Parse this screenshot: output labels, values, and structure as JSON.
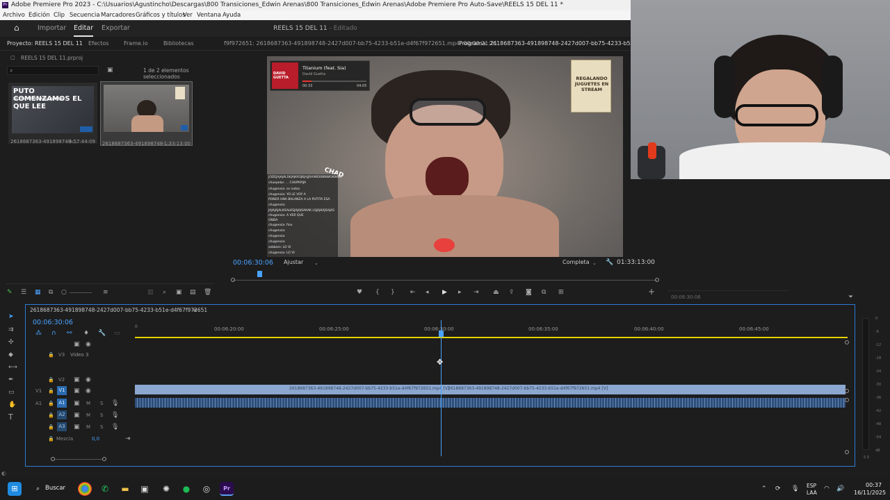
{
  "window": {
    "title": "Adobe Premiere Pro 2023 - C:\\Usuarios\\Agustincho\\Descargas\\800 Transiciones_Edwin Arenas\\800 Transiciones_Edwin Arenas\\Adobe Premiere Pro Auto-Save\\REELS 15 DEL 11 *"
  },
  "menu": [
    "Archivo",
    "Edición",
    "Clip",
    "Secuencia",
    "Marcadores",
    "Gráficos y títulos",
    "Ver",
    "Ventana",
    "Ayuda"
  ],
  "appbar": {
    "tabs": [
      "Importar",
      "Editar",
      "Exportar"
    ],
    "active": "Editar",
    "project_title": "REELS 15 DEL 11",
    "status": "Editado"
  },
  "project": {
    "tabs": [
      "Proyecto: REELS 15 DEL 11",
      "Efectos",
      "Frame.io",
      "Bibliotecas"
    ],
    "file": "REELS 15 DEL 11.prproj",
    "selection_status": "1 de 2 elementos seleccionados",
    "items": [
      {
        "name": "2618687363-491898748-...",
        "duration": "3:57:44:09",
        "overlay_title": "PUTO COMENZAMOS EL QUE LEE",
        "overlay_sub": "FALTEN PUTOS JAJAJAJAJAJAJA"
      },
      {
        "name": "2618687363-491898748-...",
        "duration": "1:33:13:00"
      }
    ]
  },
  "source": {
    "label": "f9f972651: 2618687363-491898748-2427d007-bb75-4233-b51e-d4f67f972651.mp4: 00:00:21:21"
  },
  "program": {
    "label": "Programa: 2618687363-491898748-2427d007-bb75-4233-b51e-d4f67f972651.mp4",
    "timecode": "00:06:30:06",
    "fit": "Ajustar",
    "quality": "Completa",
    "duration": "01:33:13:00"
  },
  "overlay": {
    "song": "Titanium (feat. Sia)",
    "artist": "David Guetta",
    "time_start": "00:33",
    "time_end": "04:05",
    "album": "DAVID GUETTA",
    "sign": "REGALANDO JUGUETES EN STREAM",
    "sticker": "CHAD",
    "chat": [
      "JODEJAJAJALSKJAJKKSJKJAJJSHWIEKWNWOKWNK",
      "chuepeko: ... CHUPAPIJA",
      "chugensia: es nobia",
      "chugensia: YO LE VOY A",
      "PONER UNA BALANZA A LA PUTITA ESA",
      "chugensia:",
      "JAJAJAJALKSALKSJAJAJSAKAK LSJAJKAJSAJAS",
      "chugensia: A VER QUE",
      "ONDA",
      "chugensia: fino",
      "chugensia:",
      "chugensia:",
      "chugensia:",
      "sebbien: LO VI",
      "chugensia: LO VI"
    ]
  },
  "right_panel": {
    "timecode": "00:06:30:06"
  },
  "timeline": {
    "sequence_tab": "2618687363-491898748-2427d007-bb75-4233-b51e-d4f67f972651",
    "timecode": "00:06:30:06",
    "ruler": [
      "00:06:20:00",
      "00:06:25:00",
      "00:06:30:00",
      "00:06:35:00",
      "00:06:40:00",
      "00:06:45:00"
    ],
    "tracks": [
      {
        "id": "V3",
        "label": "Vídeo 3"
      },
      {
        "id": "V2"
      },
      {
        "id": "V1",
        "target": "V1"
      },
      {
        "id": "A1",
        "target": "A1"
      },
      {
        "id": "A2"
      },
      {
        "id": "A3"
      }
    ],
    "mix": {
      "label": "Mezcla",
      "value": "0,0"
    },
    "clip_label": "2618687363-491898748-2427d007-bb75-4233-b51e-d4f67f972651.mp4 [V]",
    "meter": [
      "0",
      "-6",
      "-12",
      "-18",
      "-24",
      "-30",
      "-36",
      "-42",
      "-48",
      "-54",
      "dB"
    ],
    "meter_sol": "S S"
  },
  "taskbar": {
    "search": "Buscar",
    "lang": "ESP",
    "lang2": "LAA",
    "time": "00:37",
    "date": "16/11/2025"
  }
}
